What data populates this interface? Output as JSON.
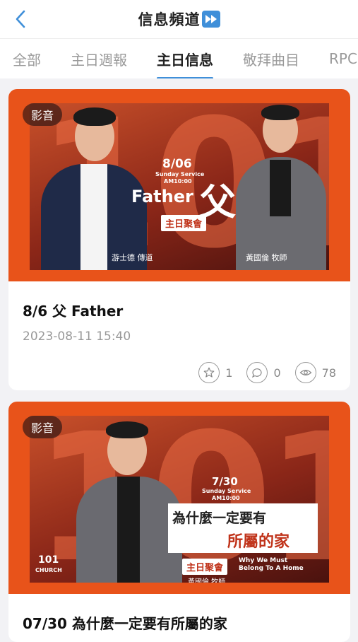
{
  "header": {
    "title": "信息頻道",
    "title_icon": "fast-forward-icon"
  },
  "tabs": [
    {
      "label": "全部",
      "active": false
    },
    {
      "label": "主日週報",
      "active": false
    },
    {
      "label": "主日信息",
      "active": true
    },
    {
      "label": "敬拜曲目",
      "active": false
    },
    {
      "label": "RPC",
      "active": false
    }
  ],
  "cards": [
    {
      "badge": "影音",
      "title": "8/6 父 Father",
      "date": "2023-08-11 15:40",
      "likes": "1",
      "comments": "0",
      "views": "78",
      "banner": {
        "big_text": "101",
        "date": "8/06",
        "service": "Sunday Service",
        "time": "AM10:00",
        "english": "Father",
        "chinese": "父",
        "meeting": "主日聚會",
        "speaker1": "游士德 傳道",
        "speaker2": "黃國倫 牧師"
      }
    },
    {
      "badge": "影音",
      "title": "07/30 為什麼一定要有所屬的家",
      "banner": {
        "big_text": "101",
        "date": "7/30",
        "service": "Sunday Service",
        "time": "AM10:00",
        "headline1": "為什麼一定要有",
        "headline2": "所屬的家",
        "meeting": "主日聚會",
        "english1": "Why We Must",
        "english2": "Belong To A Home",
        "speaker": "黃國倫 牧師",
        "logo": "101",
        "logo_sub": "CHURCH"
      }
    }
  ]
}
